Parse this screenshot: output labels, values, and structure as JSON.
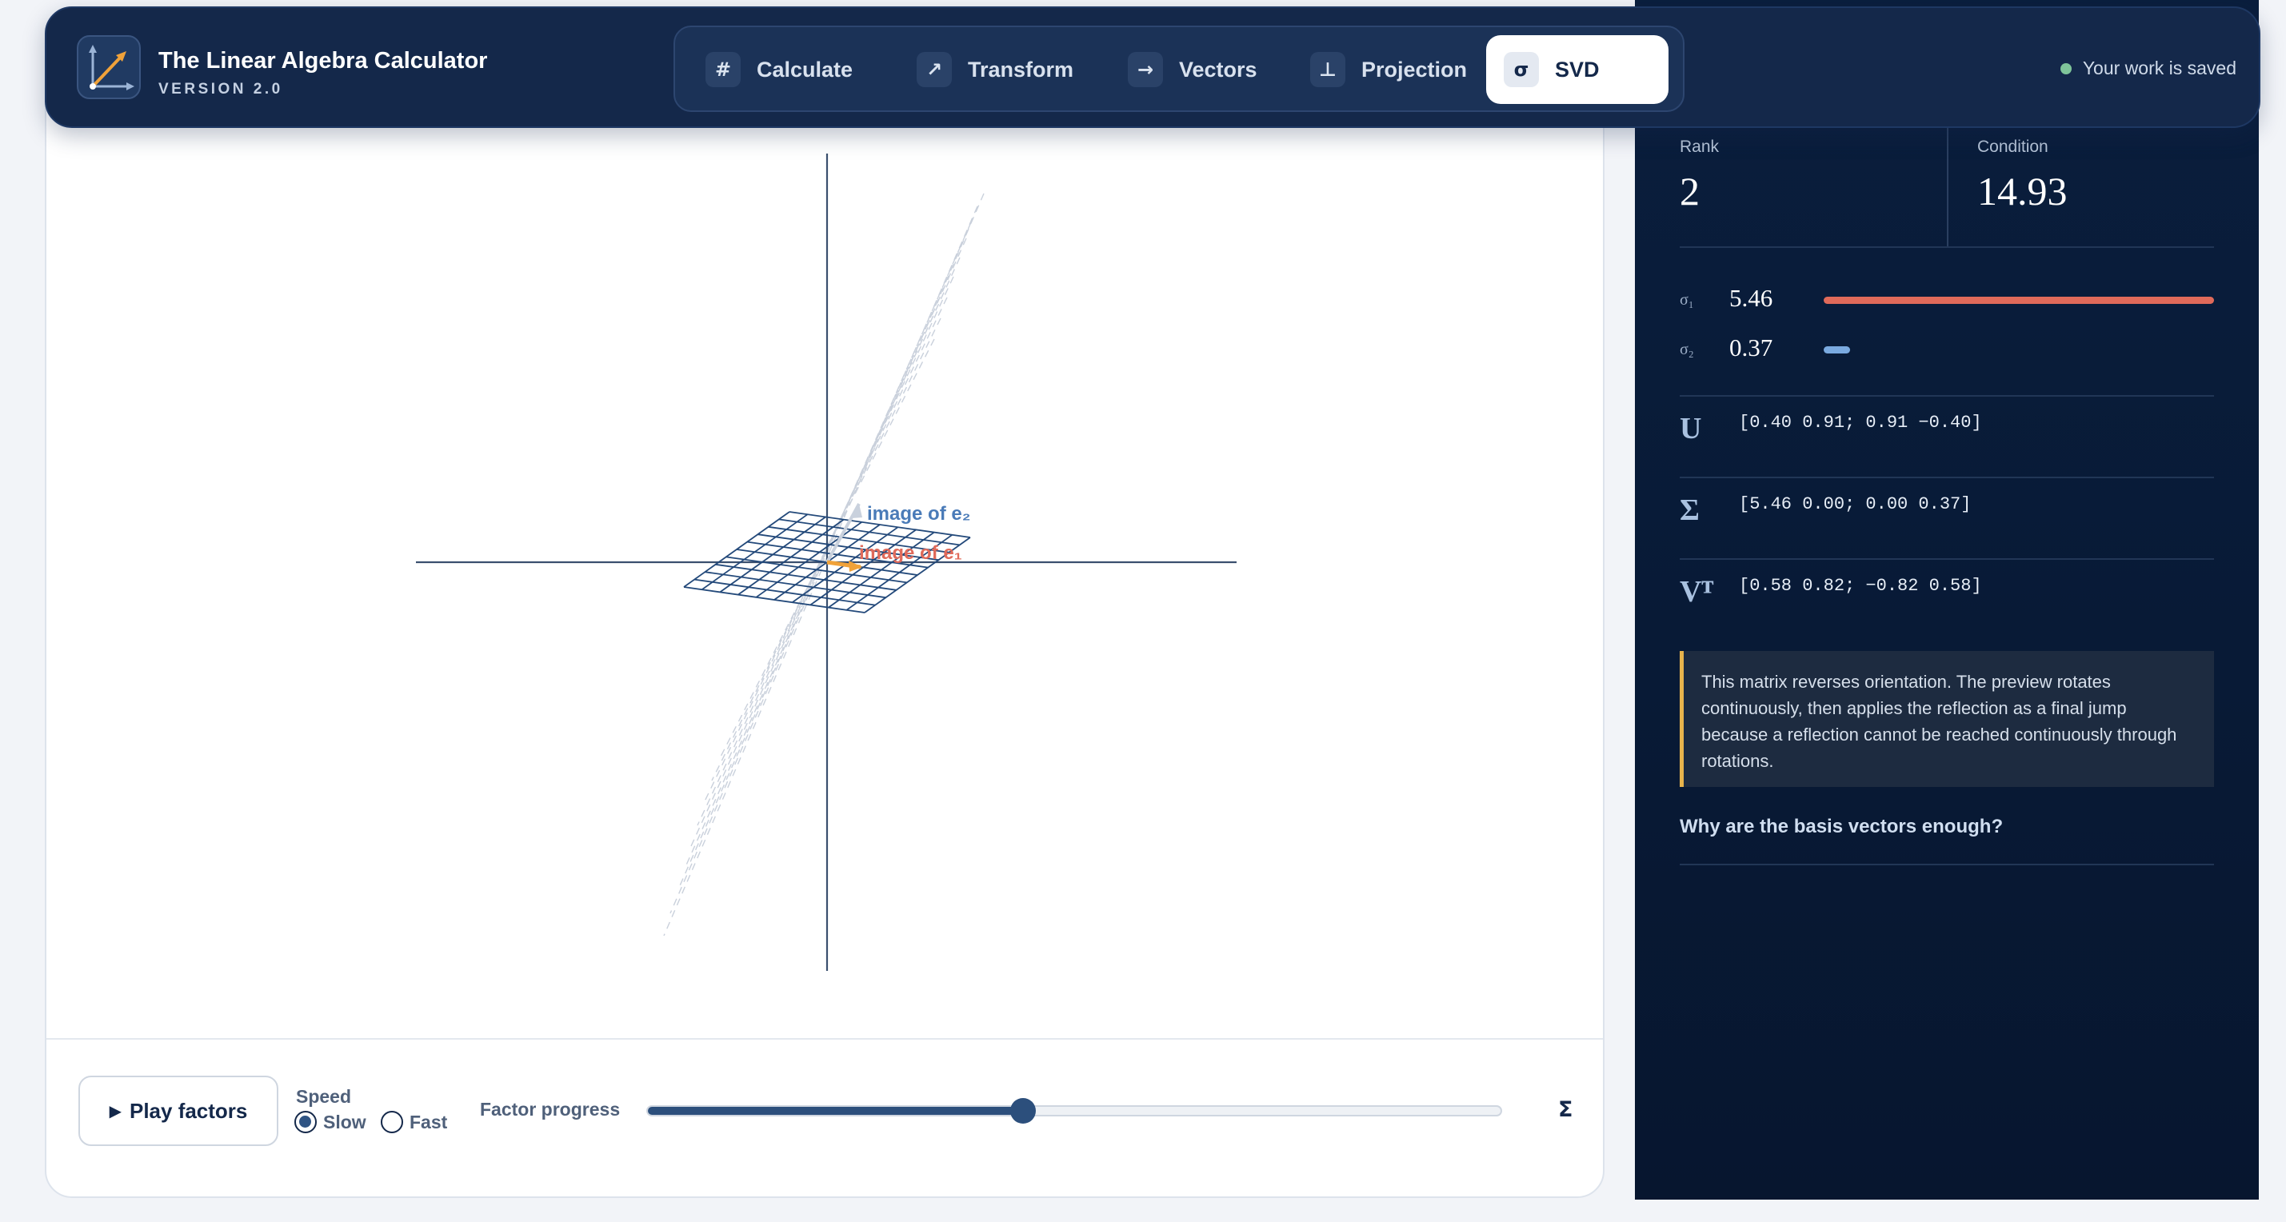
{
  "header": {
    "app_title": "The Linear Algebra Calculator",
    "app_version": "VERSION 2.0",
    "saved_status": "Your work is saved",
    "tabs": [
      {
        "label": "Calculate",
        "icon": "#",
        "icon_name": "hash-icon",
        "active": false
      },
      {
        "label": "Transform",
        "icon": "↗",
        "icon_name": "arrow-up-right-icon",
        "active": false
      },
      {
        "label": "Vectors",
        "icon": "→",
        "icon_name": "arrow-right-icon",
        "active": false
      },
      {
        "label": "Projection",
        "icon": "⊥",
        "icon_name": "perpendicular-icon",
        "active": false
      },
      {
        "label": "SVD",
        "icon": "σ",
        "icon_name": "sigma-icon",
        "active": true
      }
    ]
  },
  "canvas": {
    "label_e2": "image of e₂",
    "label_e1": "image of e₁"
  },
  "controls": {
    "play_label": "Play factors",
    "play_icon": "▶",
    "speed_label": "Speed",
    "speed_options": [
      "Slow",
      "Fast"
    ],
    "speed_selected": "Slow",
    "progress_label": "Factor progress",
    "progress_value": 0.44,
    "progress_end_symbol": "Σ"
  },
  "panel": {
    "rank_label": "Rank",
    "rank_value": "2",
    "condition_label": "Condition",
    "condition_value": "14.93",
    "singular_values": [
      {
        "name": "σ₁",
        "value": "5.46",
        "fraction": 1.0,
        "color": "#e06a5a"
      },
      {
        "name": "σ₂",
        "value": "0.37",
        "fraction": 0.068,
        "color": "#7aaae0"
      }
    ],
    "matrices": [
      {
        "name": "U",
        "value": "[0.40 0.91; 0.91 −0.40]"
      },
      {
        "name": "Σ",
        "value": "[5.46 0.00; 0.00 0.37]"
      },
      {
        "name": "Vᵀ",
        "value": "[0.58 0.82; −0.82 0.58]"
      }
    ],
    "note": "This matrix reverses orientation. The preview rotates continuously, then applies the reflection as a final jump because a reflection cannot be reached continuously through rotations.",
    "why_link": "Why are the basis vectors enough?"
  },
  "colors": {
    "header_bg": "#14284a",
    "panel_bg": "#0a1e3d",
    "accent_red": "#e06a5a",
    "accent_blue": "#7aaae0",
    "accent_orange": "#f0a23a",
    "note_border": "#e8b44c"
  }
}
